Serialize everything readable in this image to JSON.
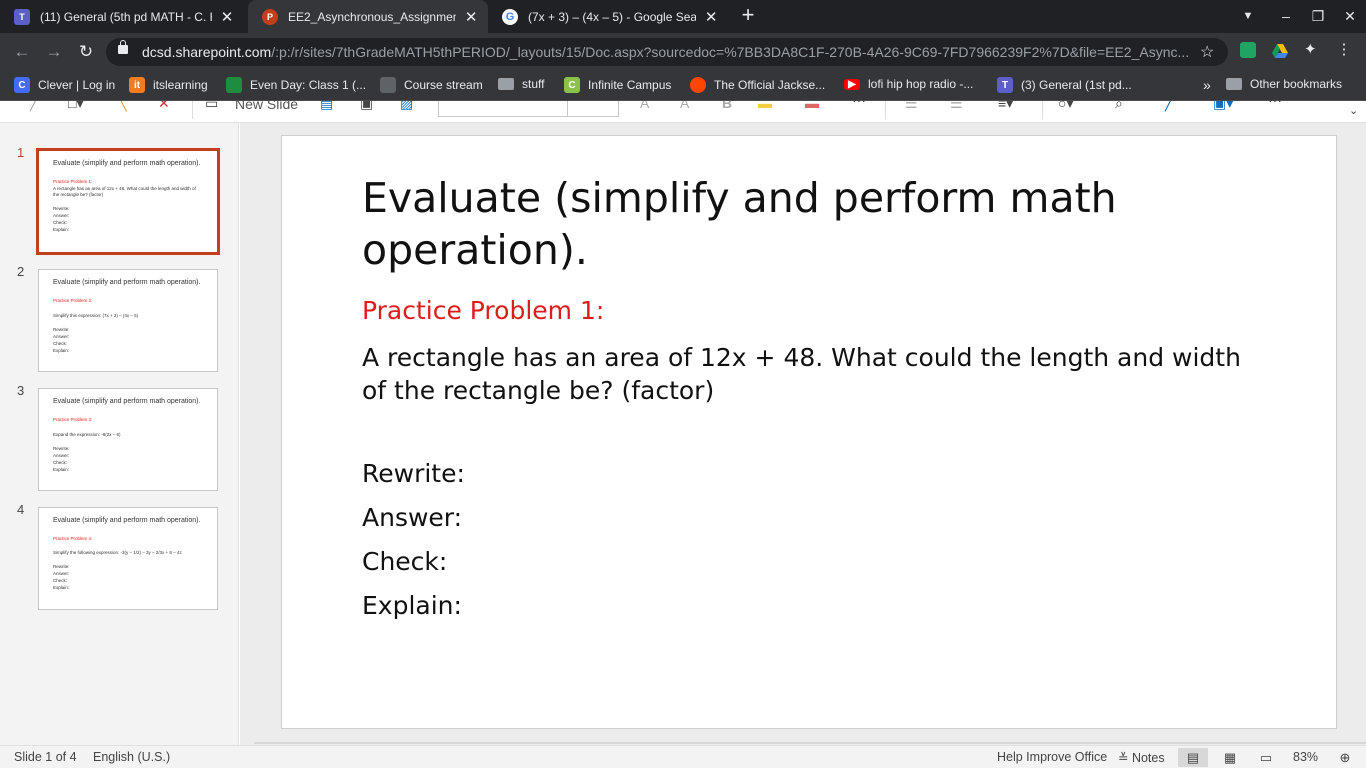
{
  "browser": {
    "tabs": [
      {
        "title": "(11) General (5th pd MATH - C. H",
        "active": false,
        "icon": "teams-icon"
      },
      {
        "title": "EE2_Asynchronous_Assignment",
        "active": true,
        "icon": "powerpoint-icon"
      },
      {
        "title": "(7x + 3) – (4x – 5)  - Google Sear",
        "active": false,
        "icon": "google-icon"
      }
    ],
    "url_host": "dcsd.sharepoint.com",
    "url_path": "/:p:/r/sites/7thGradeMATH5thPERIOD/_layouts/15/Doc.aspx?sourcedoc=%7BB3DA8C1F-270B-4A26-9C69-7FD7966239F2%7D&file=EE2_Async...",
    "bookmarks": [
      "Clever | Log in",
      "itslearning",
      "Even Day: Class 1 (...",
      "Course stream",
      "stuff",
      "Infinite Campus",
      "The Official Jackse...",
      "lofi hip hop radio -...",
      "(3) General (1st pd..."
    ],
    "other_bookmarks": "Other bookmarks",
    "colors": {
      "chrome_dark": "#202124",
      "chrome_toolbar": "#35363a",
      "accent_powerpoint": "#c43e1c",
      "problem_red": "#e01b1b"
    }
  },
  "ribbon": {
    "new_slide": "New Slide"
  },
  "thumbnails": [
    {
      "num": "1",
      "title": "Evaluate (simplify and perform math operation).",
      "problem": "Practice Problem 1:",
      "body": "A rectangle has an area of 12x + 48. What could the length and width of the rectangle be? (factor)",
      "lines": [
        "Rewrite:",
        "Answer:",
        "Check:",
        "Explain:"
      ]
    },
    {
      "num": "2",
      "title": "Evaluate (simplify and perform math operation).",
      "problem": "Practice Problem 2:",
      "body": "Simplify this expression: (7x + 3) – (4x – 5)",
      "lines": [
        "Rewrite:",
        "Answer:",
        "Check:",
        "Explain:"
      ]
    },
    {
      "num": "3",
      "title": "Evaluate (simplify and perform math operation).",
      "problem": "Practice Problem 3:",
      "body": "Expand the expression: -8(2x – 6)",
      "lines": [
        "Rewrite:",
        "Answer:",
        "Check:",
        "Explain:"
      ]
    },
    {
      "num": "4",
      "title": "Evaluate (simplify and perform math operation).",
      "problem": "Practice Problem 4:",
      "body": "Simplify the following expression: -3(y – 1/2) – 3y – 2/3x + 8 – 4z",
      "lines": [
        "Rewrite:",
        "Answer:",
        "Check:",
        "Explain:"
      ]
    }
  ],
  "slide": {
    "title": "Evaluate (simplify and perform math operation).",
    "problem": "Practice Problem 1:",
    "body": "A rectangle has an area of 12x + 48. What could the length and width of the rectangle be? (factor)",
    "rewrite": "Rewrite:",
    "answer": "Answer:",
    "check": "Check:",
    "explain": "Explain:"
  },
  "status": {
    "slide_info": "Slide 1 of 4",
    "language": "English (U.S.)",
    "help": "Help Improve Office",
    "notes": "Notes",
    "zoom": "83%"
  }
}
